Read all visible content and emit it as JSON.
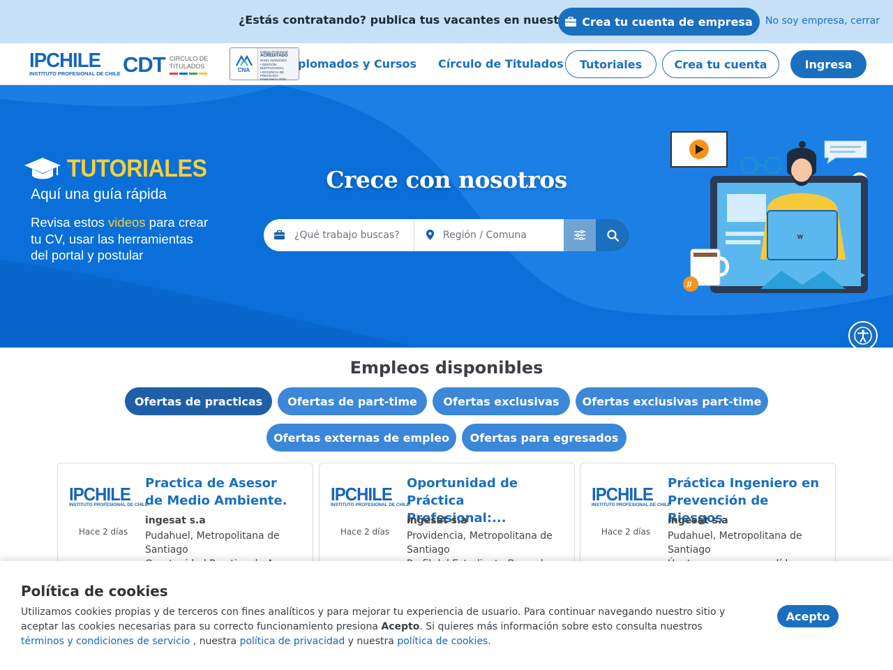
{
  "promo": {
    "text": "¿Estás contratando? publica tus vacantes en nuestra red",
    "button_label": "Crea tu cuenta de empresa",
    "close_link": "No soy empresa, cerrar"
  },
  "logos": {
    "ipchile_big": "IPCHILE",
    "ipchile_small": "INSTITUTO PROFESIONAL DE CHILE",
    "cdt": "CDT",
    "cdt_sub_line1": "CIRCULO DE",
    "cdt_sub_line2": "TITULADOS",
    "cna_short": "CNA",
    "cna_line1": "Instituto Profesional",
    "cna_line2": "ACREDITADO",
    "cna_line3": "NIVEL AVANZADO",
    "cna_line4": "• GESTIÓN INSTITUCIONAL",
    "cna_line5": "• DOCENCIA DE PREGRADO",
    "cna_line6": "Hasta Marzo 2025"
  },
  "nav": {
    "diplomados": "plomados y Cursos",
    "circulo": "Círculo de Titulados",
    "tutoriales": "Tutoriales",
    "crea_cuenta": "Crea tu cuenta",
    "ingresa": "Ingresa"
  },
  "hero": {
    "tut_title": "TUTORIALES",
    "tut_sub": "Aquí una guía rápida",
    "tut_body_1": "Revisa estos ",
    "tut_body_hl": "videos",
    "tut_body_2": " para crear tu CV, usar las herramientas del portal y postular",
    "title": "Crece con nosotros",
    "job_placeholder": "¿Qué trabajo buscas?",
    "location_placeholder": "Región / Comuna"
  },
  "jobs": {
    "title": "Empleos disponibles",
    "filters": [
      "Ofertas de practicas",
      "Ofertas de part-time",
      "Ofertas exclusivas",
      "Ofertas exclusivas part-time",
      "Ofertas externas de empleo",
      "Ofertas para egresados"
    ],
    "cards": [
      {
        "title": "Practica de Asesor de Medio Ambiente.",
        "when": "Hace 2 días",
        "company": "ingesat s.a",
        "place": "Pudahuel, Metropolitana de Santiago",
        "desc": "Oportunidad Practica de Asesor"
      },
      {
        "title": "Oportunidad de Práctica Profesional:...",
        "when": "Hace 2 días",
        "company": "ingesat s.a",
        "place": "Providencia, Metropolitana de Santiago",
        "desc": "Perfil del Estudiante Buscado"
      },
      {
        "title": "Práctica Ingeniero en Prevención de Riesgos",
        "when": "Hace 2 días",
        "company": "ingesat s.a",
        "place": "Pudahuel, Metropolitana de Santiago",
        "desc": "Únete a una empresa líder en"
      }
    ]
  },
  "cookie": {
    "title": "Política de cookies",
    "text_1": "Utilizamos cookies propias y de terceros con fines analíticos y para mejorar tu experiencia de usuario. Para continuar navegando nuestro sitio y aceptar las cookies necesarias para su correcto funcionamiento presiona ",
    "text_bold": "Acepto",
    "text_2": ". Si quieres más información sobre esto consulta nuestros ",
    "link_terms": "términos y condiciones de servicio",
    "text_3": " , nuestra ",
    "link_privacy": "política de privacidad",
    "text_4": " y nuestra ",
    "link_cookies": "política de cookies",
    "text_5": ".",
    "accept_label": "Acepto"
  },
  "colors": {
    "primary": "#1a6fbf",
    "promo_bg": "#c6e1f7",
    "hero_bg": "#0a6fd8",
    "accent_yellow": "#f7d038"
  },
  "icons": [
    "briefcase-icon",
    "location-pin-icon",
    "filter-sliders-icon",
    "search-icon",
    "accessibility-icon",
    "graduation-cap-icon",
    "play-icon"
  ]
}
